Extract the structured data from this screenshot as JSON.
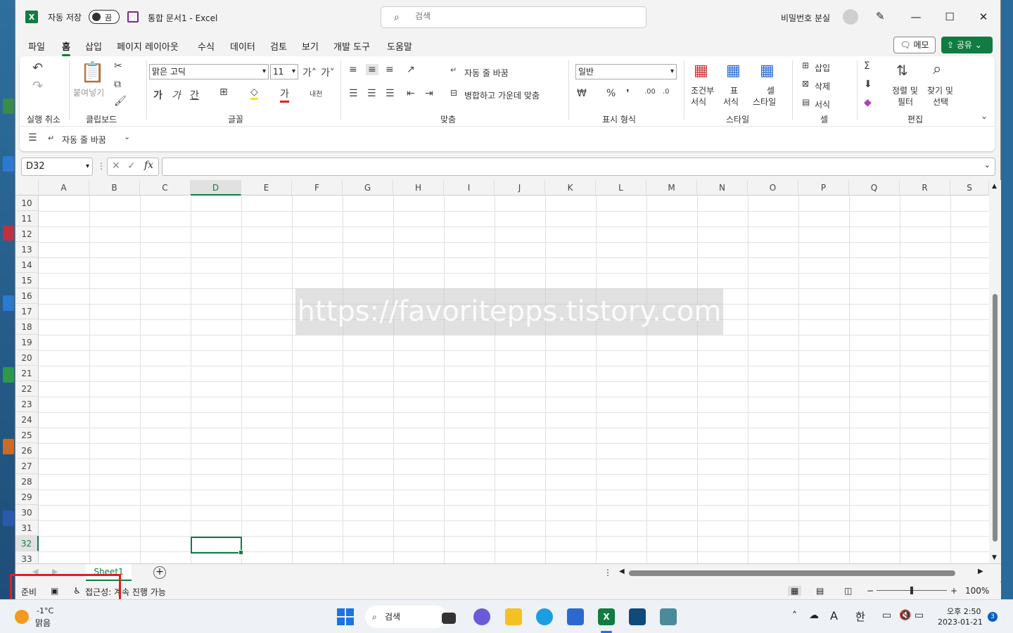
{
  "window": {
    "autosave_label": "자동 저장",
    "autosave_state": "끔",
    "doc_title": "통합 문서1  -  Excel",
    "search_placeholder": "검색",
    "user_name": "비밀번호 분실"
  },
  "tabs": [
    "파일",
    "홈",
    "삽입",
    "페이지 레이아웃",
    "수식",
    "데이터",
    "검토",
    "보기",
    "개발 도구",
    "도움말"
  ],
  "active_tab": "홈",
  "memo_label": "메모",
  "share_label": "공유",
  "ribbon": {
    "undo_group": "실행 취소",
    "clipboard_group": "클립보드",
    "paste_label": "붙여넣기",
    "font_group": "글꼴",
    "font_name": "맑은 고딕",
    "font_size": "11",
    "align_group": "맞춤",
    "wrap_text": "자동 줄 바꿈",
    "merge_center": "병합하고 가운데 맞춤",
    "number_group": "표시 형식",
    "number_format": "일반",
    "styles_group": "스타일",
    "cond_format_1": "조건부",
    "cond_format_2": "서식",
    "table_format_1": "표",
    "table_format_2": "서식",
    "cell_style_1": "셀",
    "cell_style_2": "스타일",
    "cells_group": "셀",
    "insert": "삽입",
    "delete": "삭제",
    "format": "서식",
    "edit_group": "편집",
    "sort_filter_1": "정렬 및",
    "sort_filter_2": "필터",
    "find_select_1": "찾기 및",
    "find_select_2": "선택",
    "qat_wrap": "자동 줄 바꿈"
  },
  "formula_bar": {
    "name_box": "D32",
    "fx": "fx",
    "value": ""
  },
  "columns": [
    "A",
    "B",
    "C",
    "D",
    "E",
    "F",
    "G",
    "H",
    "I",
    "J",
    "K",
    "L",
    "M",
    "N",
    "O",
    "P",
    "Q",
    "R",
    "S"
  ],
  "selected_column": "D",
  "rows": [
    "10",
    "11",
    "12",
    "13",
    "14",
    "15",
    "16",
    "17",
    "18",
    "19",
    "20",
    "21",
    "22",
    "23",
    "24",
    "25",
    "26",
    "27",
    "28",
    "29",
    "30",
    "31",
    "32",
    "33"
  ],
  "selected_row": "32",
  "watermark": "https://favoritepps.tistory.com",
  "sheet_tab": "Sheet1",
  "status": {
    "ready": "준비",
    "accessibility": "접근성: 계속 진행 가능",
    "zoom": "100%"
  },
  "taskbar": {
    "temp": "-1°C",
    "weather": "맑음",
    "search": "검색",
    "ime": "한",
    "ime_a": "A",
    "time": "오후 2:50",
    "date": "2023-01-21",
    "notifications": "3"
  },
  "colors": {
    "accent": "#107c41",
    "highlight": "#e02020"
  }
}
